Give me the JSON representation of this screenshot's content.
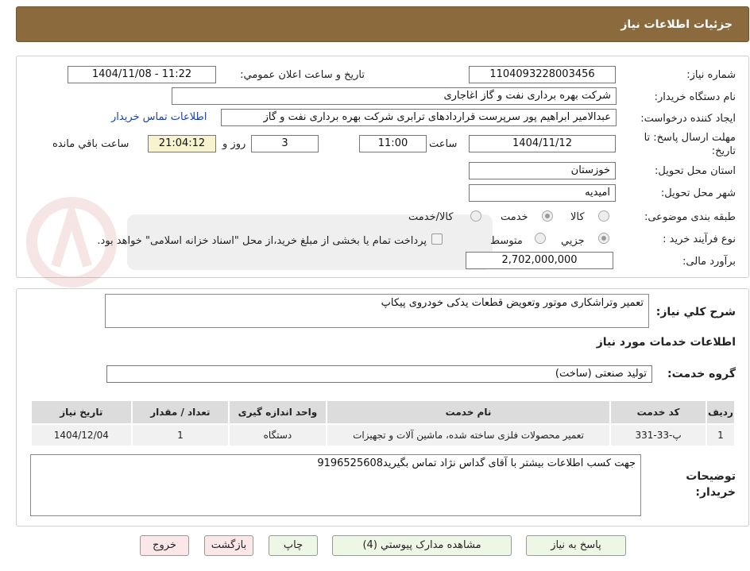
{
  "title": "جزئیات اطلاعات نیاز",
  "form": {
    "need_number_label": "شماره نیاز:",
    "need_number": "1104093228003456",
    "announce_label": "تاریخ و ساعت اعلان عمومي:",
    "announce_value": "1404/11/08 - 11:22",
    "buyer_org_label": "نام دستگاه خريدار:",
    "buyer_org": "شرکت بهره برداری نفت و گاز اغاجاری",
    "requester_label": "ايجاد کننده درخواست:",
    "requester": "عبدالامیر ابراهیم پور سرپرست قراردادهای ترابری شرکت بهره برداری نفت و گاز",
    "contact_link": "اطلاعات تماس خريدار",
    "deadline_label": "مهلت ارسال پاسخ: تا تاریخ:",
    "deadline_date": "1404/11/12",
    "time_label": "ساعت",
    "deadline_time": "11:00",
    "days_value": "3",
    "days_label": "روز و",
    "remaining_time": "21:04:12",
    "remaining_label": "ساعت باقي مانده",
    "province_label": "استان محل تحویل:",
    "province": "خوزستان",
    "city_label": "شهر محل تحویل:",
    "city": "امیدیه",
    "category_label": "طبقه بندی موضوعی:",
    "category_options": [
      "کالا",
      "خدمت",
      "کالا/خدمت"
    ],
    "category_selected": "خدمت",
    "process_label": "نوع فرآیند خرید :",
    "process_options": [
      "جزیي",
      "متوسط"
    ],
    "process_selected": "جزیي",
    "payment_note": "پرداخت تمام یا بخشی از مبلغ خرید،از محل \"اسناد خزانه اسلامی\" خواهد بود.",
    "budget_label": "برآورد مالی:",
    "budget": "2,702,000,000"
  },
  "summary": {
    "label": "شرح کلي نياز:",
    "value": "تعمیر وتراشکاری موتور وتعویض قطعات یدکی خودروی پیکاپ"
  },
  "services": {
    "section_title": "اطلاعات خدمات مورد نياز",
    "group_label": "گروه خدمت:",
    "group_value": "تولید صنعتی (ساخت)",
    "headers": [
      "رديف",
      "کد خدمت",
      "نام خدمت",
      "واحد اندازه گيری",
      "تعداد / مقدار",
      "تاريخ نياز"
    ],
    "rows": [
      [
        "1",
        "پ-33-331",
        "تعمیر محصولات فلزی ساخته شده، ماشین آلات و تجهیزات",
        "دستگاه",
        "1",
        "1404/12/04"
      ]
    ]
  },
  "buyer_notes": {
    "label": "توضيحات خريدار:",
    "value": "جهت کسب اطلاعات بیشتر با آقای گداس نژاد تماس بگیرید9196525608"
  },
  "buttons": {
    "reply": "پاسخ به نياز",
    "attachments": "مشاهده مدارک پيوستي (4)",
    "print": "چاپ",
    "back": "بازگشت",
    "exit": "خروج"
  },
  "colors": {
    "title_bar": "#8B6B3D",
    "link": "#1a3fb0",
    "green_button": "#eef7e6",
    "red_button": "#fbe6e8"
  }
}
